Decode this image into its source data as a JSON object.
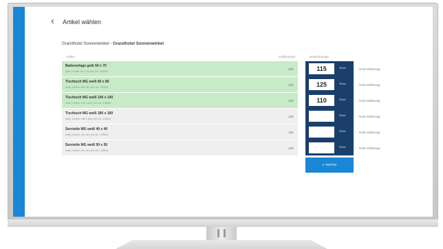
{
  "page": {
    "back_icon": "chevron-left-icon",
    "title": "Artikel wählen",
    "hotel_prefix": "Grandhotel Sonnenwinkel - ",
    "hotel_name": "Grandhotel Sonnenwinkel"
  },
  "table": {
    "headers": {
      "article": "Artikel",
      "target_stock": "Sollbestand",
      "order_qty": "Bestellmenge"
    },
    "rows": [
      {
        "name": "Badevorlage gelb 50 x 70",
        "meta": "gelb | Größe: 50 x 70 | Art.-Nr.: 120003",
        "stock": "120",
        "qty": "115",
        "unit": "Stück",
        "status": "keine Erfassung",
        "highlighted": true
      },
      {
        "name": "Tischtuch MG weiß 80 x 80",
        "meta": "weiß | Größe: 80 x 80 | Art.-Nr.: 130001",
        "stock": "120",
        "qty": "125",
        "unit": "Stück",
        "status": "keine Erfassung",
        "highlighted": true
      },
      {
        "name": "Tischtuch MG weiß 140 x 140",
        "meta": "weiß | Größe: 140 x 140 | Art.-Nr.: 130001",
        "stock": "120",
        "qty": "110",
        "unit": "Stück",
        "status": "keine Erfassung",
        "highlighted": true
      },
      {
        "name": "Tischtuch MG weiß 180 x 180",
        "meta": "weiß | Größe: 180 x 180 | Art.-Nr.: 130001",
        "stock": "120",
        "qty": "",
        "unit": "Stück",
        "status": "keine Erfassung",
        "highlighted": false
      },
      {
        "name": "Serviette MG weiß 40 x 40",
        "meta": "weiß | Größe: 40 x 40 | Art.-Nr.: 130011",
        "stock": "120",
        "qty": "",
        "unit": "Stück",
        "status": "keine Erfassung",
        "highlighted": false
      },
      {
        "name": "Serviette MG weiß 50 x 50",
        "meta": "weiß | Größe: 50 x 50 | Art.-Nr.: 130011",
        "stock": "120",
        "qty": "",
        "unit": "Stück",
        "status": "keine Erfassung",
        "highlighted": false
      }
    ]
  },
  "done_button": {
    "icon": "checkmark-icon",
    "label": "FERTIG"
  },
  "colors": {
    "accent": "#1a86d6",
    "order_panel": "#1b3f6b",
    "row_highlight": "#c7ebc6",
    "row_default": "#efefef"
  }
}
